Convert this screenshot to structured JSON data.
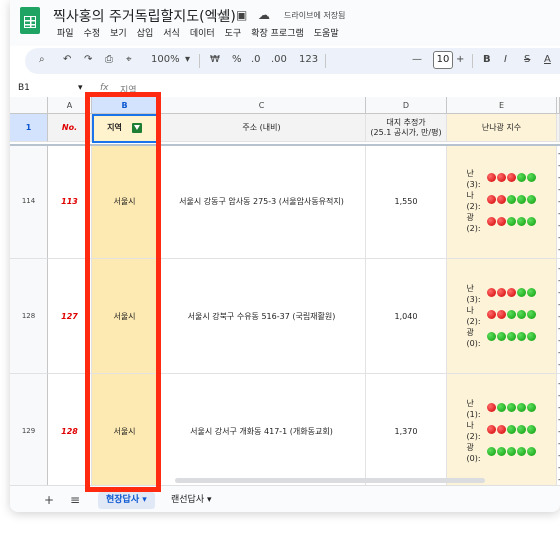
{
  "window": {
    "title": "찍사홍의 주거독립할지도(엑셀)",
    "save_status": "드라이브에 저장됨",
    "menu": [
      "파일",
      "수정",
      "보기",
      "삽입",
      "서식",
      "데이터",
      "도구",
      "확장 프로그램",
      "도움말"
    ]
  },
  "toolbar": {
    "zoom": "100%",
    "currency": "₩",
    "percent": "%",
    "dec_less": ".0",
    "dec_more": ".00",
    "number_format": "123",
    "font_size": "10",
    "minus": "—",
    "plus": "+",
    "bold": "B",
    "italic": "I",
    "strike": "S",
    "text_color": "A"
  },
  "formula_bar": {
    "name_box": "B1",
    "fx": "fx",
    "content": "지역"
  },
  "columns": [
    "A",
    "B",
    "C",
    "D",
    "E"
  ],
  "header_row": {
    "row_number": "1",
    "no": "No.",
    "region": "지역",
    "address": "주소 (내비)",
    "price_line1": "대지 추정가",
    "price_line2": "(25.1 공시가, 만/평)",
    "index": "난나광 지수"
  },
  "rows": [
    {
      "row_number": "114",
      "no": "113",
      "region": "서울시",
      "address": "서울시 강동구 암사동 275-3 (서울암사동유적지)",
      "price": "1,550",
      "lights": [
        {
          "label": "난(3):",
          "colors": [
            "r",
            "r",
            "r",
            "g",
            "g"
          ]
        },
        {
          "label": "나(2):",
          "colors": [
            "r",
            "r",
            "g",
            "g",
            "g"
          ]
        },
        {
          "label": "광(2):",
          "colors": [
            "r",
            "r",
            "g",
            "g",
            "g"
          ]
        }
      ],
      "notes": [
        "-항",
        "-최",
        "-크",
        "-용",
        "-건",
        "-도",
        "-배",
        "-장",
        "-단"
      ]
    },
    {
      "row_number": "128",
      "no": "127",
      "region": "서울시",
      "address": "서울시 강북구 수유동 516-37 (국립재활원)",
      "price": "1,040",
      "lights": [
        {
          "label": "난(3):",
          "colors": [
            "r",
            "r",
            "r",
            "g",
            "g"
          ]
        },
        {
          "label": "나(2):",
          "colors": [
            "r",
            "r",
            "g",
            "g",
            "g"
          ]
        },
        {
          "label": "광(0):",
          "colors": [
            "g",
            "g",
            "g",
            "g",
            "g"
          ]
        }
      ],
      "notes": [
        "-항",
        "-최",
        "-크",
        "-용",
        "-건",
        "-도",
        "-배",
        "-장",
        "-단"
      ]
    },
    {
      "row_number": "129",
      "no": "128",
      "region": "서울시",
      "address": "서울시 강서구 개화동 417-1 (개화동교회)",
      "price": "1,370",
      "lights": [
        {
          "label": "난(1):",
          "colors": [
            "r",
            "g",
            "g",
            "g",
            "g"
          ]
        },
        {
          "label": "나(2):",
          "colors": [
            "r",
            "r",
            "g",
            "g",
            "g"
          ]
        },
        {
          "label": "광(0):",
          "colors": [
            "g",
            "g",
            "g",
            "g",
            "g"
          ]
        }
      ],
      "notes": [
        "-항",
        "-최",
        "-크",
        "-용",
        "-건",
        "-도",
        "-배",
        "-장",
        "-단"
      ]
    }
  ],
  "sheets": [
    {
      "label": "현장답사",
      "active": true
    },
    {
      "label": "랜선답사",
      "active": false
    }
  ],
  "colors": {
    "highlight_border": "#ff2a10",
    "region_fill": "#fde9b2",
    "index_fill": "#fdf3d8",
    "no_text": "#e00000",
    "light_red": "#d10000",
    "light_green": "#0c9c0c"
  }
}
